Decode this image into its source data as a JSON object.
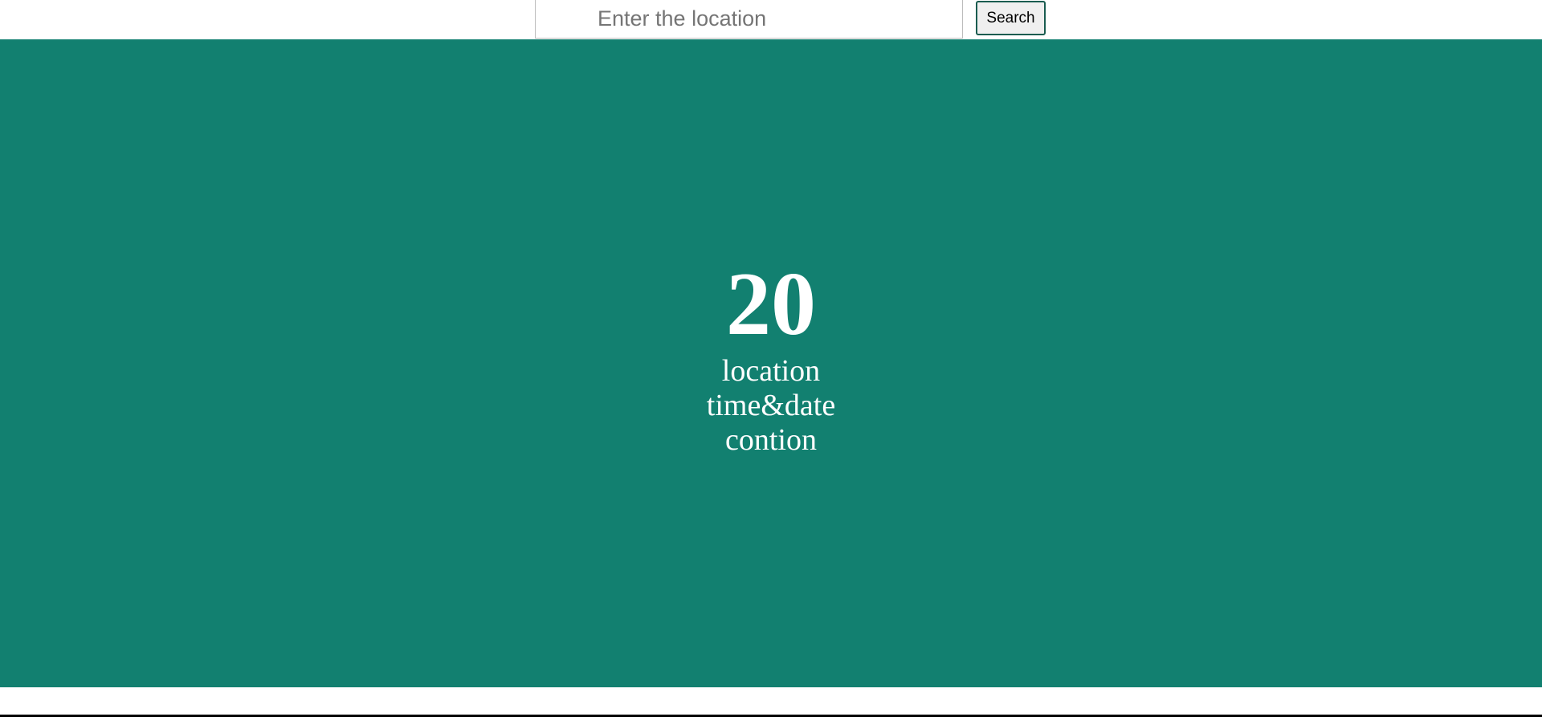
{
  "search": {
    "placeholder": "Enter the location",
    "value": "",
    "button_label": "Search"
  },
  "weather": {
    "temperature": "20",
    "location": "location",
    "time_date": "time&date",
    "condition": "contion"
  },
  "colors": {
    "panel_background": "#128070",
    "panel_text": "#ffffff",
    "button_border": "#1a5c50"
  }
}
